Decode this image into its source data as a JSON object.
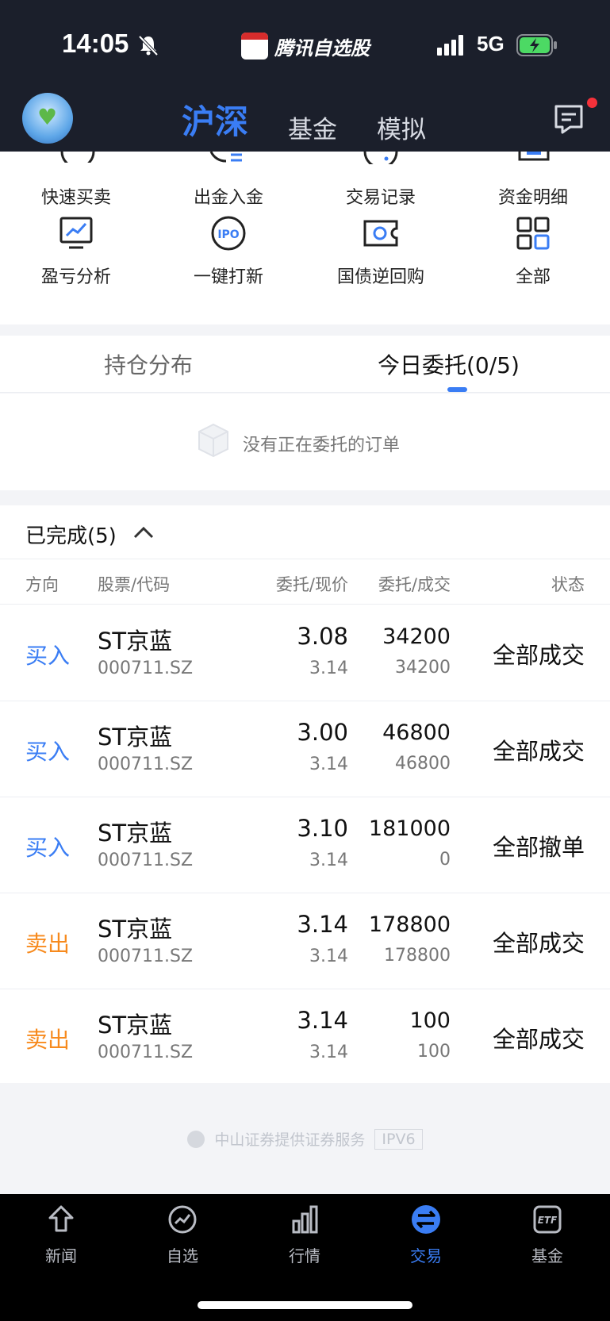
{
  "status_bar": {
    "time": "14:05",
    "carrier": "腾讯自选股",
    "network": "5G"
  },
  "nav": {
    "tabs": [
      "沪深",
      "基金",
      "模拟"
    ],
    "active_tab": "沪深"
  },
  "quick_actions": [
    {
      "label": "快速买卖",
      "icon": "quick-trade-icon"
    },
    {
      "label": "出金入金",
      "icon": "transfer-icon"
    },
    {
      "label": "交易记录",
      "icon": "history-icon"
    },
    {
      "label": "资金明细",
      "icon": "fund-detail-icon"
    },
    {
      "label": "盈亏分析",
      "icon": "profit-chart-icon"
    },
    {
      "label": "一键打新",
      "icon": "ipo-icon"
    },
    {
      "label": "国债逆回购",
      "icon": "bond-repo-icon"
    },
    {
      "label": "全部",
      "icon": "grid-icon"
    }
  ],
  "tabs": {
    "holding": "持仓分布",
    "today_orders": "今日委托(0/5)",
    "active": "today_orders"
  },
  "empty_state": {
    "text": "没有正在委托的订单"
  },
  "completed": {
    "title": "已完成(5)",
    "columns": {
      "direction": "方向",
      "stock": "股票/代码",
      "price": "委托/现价",
      "qty": "委托/成交",
      "status": "状态"
    },
    "rows": [
      {
        "direction": "买入",
        "side": "buy",
        "name": "ST京蓝",
        "code": "000711.SZ",
        "order_price": "3.08",
        "current_price": "3.14",
        "order_qty": "34200",
        "filled_qty": "34200",
        "status": "全部成交"
      },
      {
        "direction": "买入",
        "side": "buy",
        "name": "ST京蓝",
        "code": "000711.SZ",
        "order_price": "3.00",
        "current_price": "3.14",
        "order_qty": "46800",
        "filled_qty": "46800",
        "status": "全部成交"
      },
      {
        "direction": "买入",
        "side": "buy",
        "name": "ST京蓝",
        "code": "000711.SZ",
        "order_price": "3.10",
        "current_price": "3.14",
        "order_qty": "181000",
        "filled_qty": "0",
        "status": "全部撤单"
      },
      {
        "direction": "卖出",
        "side": "sell",
        "name": "ST京蓝",
        "code": "000711.SZ",
        "order_price": "3.14",
        "current_price": "3.14",
        "order_qty": "178800",
        "filled_qty": "178800",
        "status": "全部成交"
      },
      {
        "direction": "卖出",
        "side": "sell",
        "name": "ST京蓝",
        "code": "000711.SZ",
        "order_price": "3.14",
        "current_price": "3.14",
        "order_qty": "100",
        "filled_qty": "100",
        "status": "全部成交"
      }
    ]
  },
  "footer": {
    "text": "中山证券提供证券服务",
    "tag": "IPV6"
  },
  "tabbar": {
    "items": [
      {
        "label": "新闻",
        "icon": "news-icon"
      },
      {
        "label": "自选",
        "icon": "watchlist-icon"
      },
      {
        "label": "行情",
        "icon": "market-icon"
      },
      {
        "label": "交易",
        "icon": "trade-icon"
      },
      {
        "label": "基金",
        "icon": "etf-icon"
      }
    ],
    "active": "交易"
  },
  "colors": {
    "accent": "#3a7df4",
    "buy": "#3a7df4",
    "sell": "#f78a1d",
    "header_bg": "#1b1f2b"
  }
}
